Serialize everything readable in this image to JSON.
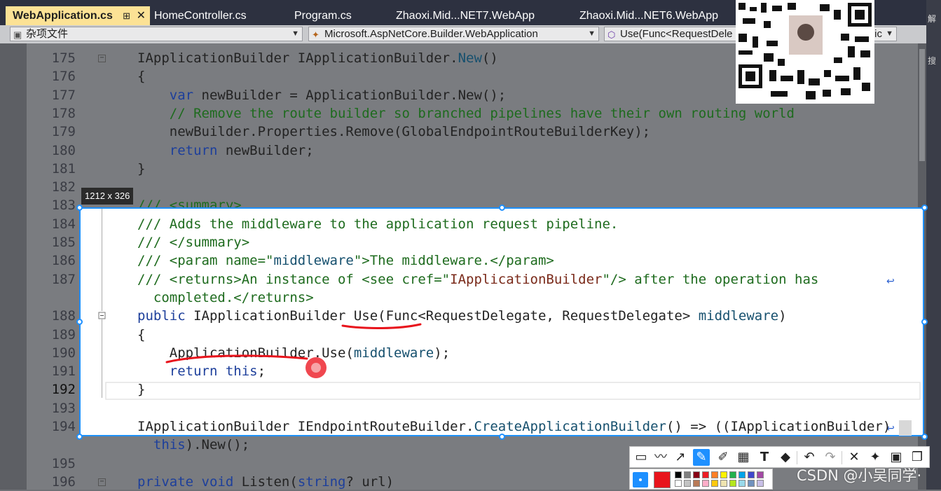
{
  "tabs": [
    {
      "label": "WebApplication.cs",
      "active": true
    },
    {
      "label": "HomeController.cs",
      "active": false
    },
    {
      "label": "Program.cs",
      "active": false
    },
    {
      "label": "Zhaoxi.Mid...NET7.WebApp",
      "active": false
    },
    {
      "label": "Zhaoxi.Mid...NET6.WebApp",
      "active": false
    }
  ],
  "nav": {
    "project": "杂项文件",
    "type": "Microsoft.AspNetCore.Builder.WebApplication",
    "member": "Use(Func<RequestDele",
    "member_tail": "ic"
  },
  "solution_strip": {
    "top": "解",
    "search": "搜"
  },
  "selection_size": "1212 x 326",
  "watermark": "CSDN @小吴同学·",
  "colors": {
    "selection": "#1e90ff",
    "annotation": "#e8141c",
    "active_tab": "#fce295"
  },
  "icons": [
    "pin-icon",
    "close-icon",
    "file-icon",
    "class-icon",
    "method-icon",
    "split-icon",
    "wrap-icon",
    "qr-code-icon"
  ],
  "toolbar_tools": [
    "rectangle-tool",
    "freehand-tool",
    "arrow-tool",
    "pen-tool",
    "highlighter-tool",
    "mosaic-tool",
    "text-tool",
    "eraser-tool",
    "undo",
    "redo",
    "cancel",
    "pin",
    "save",
    "copy"
  ],
  "lines": [
    {
      "n": "175",
      "code": [
        {
          "t": "IApplicationBuilder IApplicationBuilder.",
          "c": ""
        },
        {
          "t": "New",
          "c": "tp"
        },
        {
          "t": "()",
          "c": ""
        }
      ]
    },
    {
      "n": "176",
      "code": [
        {
          "t": "{",
          "c": ""
        }
      ]
    },
    {
      "n": "177",
      "code": [
        {
          "t": "    ",
          "c": ""
        },
        {
          "t": "var",
          "c": "kw"
        },
        {
          "t": " newBuilder = ApplicationBuilder.New();",
          "c": ""
        }
      ]
    },
    {
      "n": "178",
      "code": [
        {
          "t": "    // Remove the route builder so branched pipelines have their own routing world",
          "c": "cm"
        }
      ]
    },
    {
      "n": "179",
      "code": [
        {
          "t": "    newBuilder.Properties.Remove(GlobalEndpointRouteBuilderKey);",
          "c": ""
        }
      ]
    },
    {
      "n": "180",
      "code": [
        {
          "t": "    ",
          "c": ""
        },
        {
          "t": "return",
          "c": "kw"
        },
        {
          "t": " newBuilder;",
          "c": ""
        }
      ]
    },
    {
      "n": "181",
      "code": [
        {
          "t": "}",
          "c": ""
        }
      ]
    },
    {
      "n": "182",
      "code": []
    },
    {
      "n": "183",
      "code": [
        {
          "t": "/// <summary>",
          "c": "cm"
        }
      ]
    },
    {
      "n": "184",
      "code": [
        {
          "t": "/// Adds the middleware to the application request pipeline.",
          "c": "cm"
        }
      ]
    },
    {
      "n": "185",
      "code": [
        {
          "t": "/// </summary>",
          "c": "cm"
        }
      ]
    },
    {
      "n": "186",
      "code": [
        {
          "t": "/// <param name=\"",
          "c": "cm"
        },
        {
          "t": "middleware",
          "c": "tp"
        },
        {
          "t": "\">The middleware.</param>",
          "c": "cm"
        }
      ]
    },
    {
      "n": "187",
      "code": [
        {
          "t": "/// <returns>An instance of <see cref=\"",
          "c": "cm"
        },
        {
          "t": "IApplicationBuilder",
          "c": "st"
        },
        {
          "t": "\"/> after the operation has",
          "c": "cm"
        }
      ]
    },
    {
      "n": "",
      "code": [
        {
          "t": "  completed.</returns>",
          "c": "cm"
        }
      ]
    },
    {
      "n": "188",
      "code": [
        {
          "t": "public",
          "c": "kw"
        },
        {
          "t": " IApplicationBuilder Use(Func<RequestDelegate, RequestDelegate> ",
          "c": ""
        },
        {
          "t": "middleware",
          "c": "tp"
        },
        {
          "t": ")",
          "c": ""
        }
      ]
    },
    {
      "n": "189",
      "code": [
        {
          "t": "{",
          "c": ""
        }
      ]
    },
    {
      "n": "190",
      "code": [
        {
          "t": "    ApplicationBuilder.Use(",
          "c": ""
        },
        {
          "t": "middleware",
          "c": "tp"
        },
        {
          "t": ");",
          "c": ""
        }
      ]
    },
    {
      "n": "191",
      "code": [
        {
          "t": "    ",
          "c": ""
        },
        {
          "t": "return",
          "c": "kw"
        },
        {
          "t": " ",
          "c": ""
        },
        {
          "t": "this",
          "c": "kw"
        },
        {
          "t": ";",
          "c": ""
        }
      ]
    },
    {
      "n": "192",
      "code": [
        {
          "t": "}",
          "c": ""
        }
      ]
    },
    {
      "n": "193",
      "code": []
    },
    {
      "n": "194",
      "code": [
        {
          "t": "IApplicationBuilder IEndpointRouteBuilder.",
          "c": ""
        },
        {
          "t": "CreateApplicationBuilder",
          "c": "tp"
        },
        {
          "t": "() => ((IApplicationBuilder)",
          "c": ""
        }
      ]
    },
    {
      "n": "",
      "code": [
        {
          "t": "  ",
          "c": ""
        },
        {
          "t": "this",
          "c": "kw"
        },
        {
          "t": ").New();",
          "c": ""
        }
      ]
    },
    {
      "n": "195",
      "code": []
    },
    {
      "n": "196",
      "code": [
        {
          "t": "private",
          "c": "kw"
        },
        {
          "t": " ",
          "c": ""
        },
        {
          "t": "void",
          "c": "kw"
        },
        {
          "t": " Listen(",
          "c": ""
        },
        {
          "t": "string",
          "c": "kw"
        },
        {
          "t": "? url)",
          "c": ""
        }
      ]
    }
  ]
}
